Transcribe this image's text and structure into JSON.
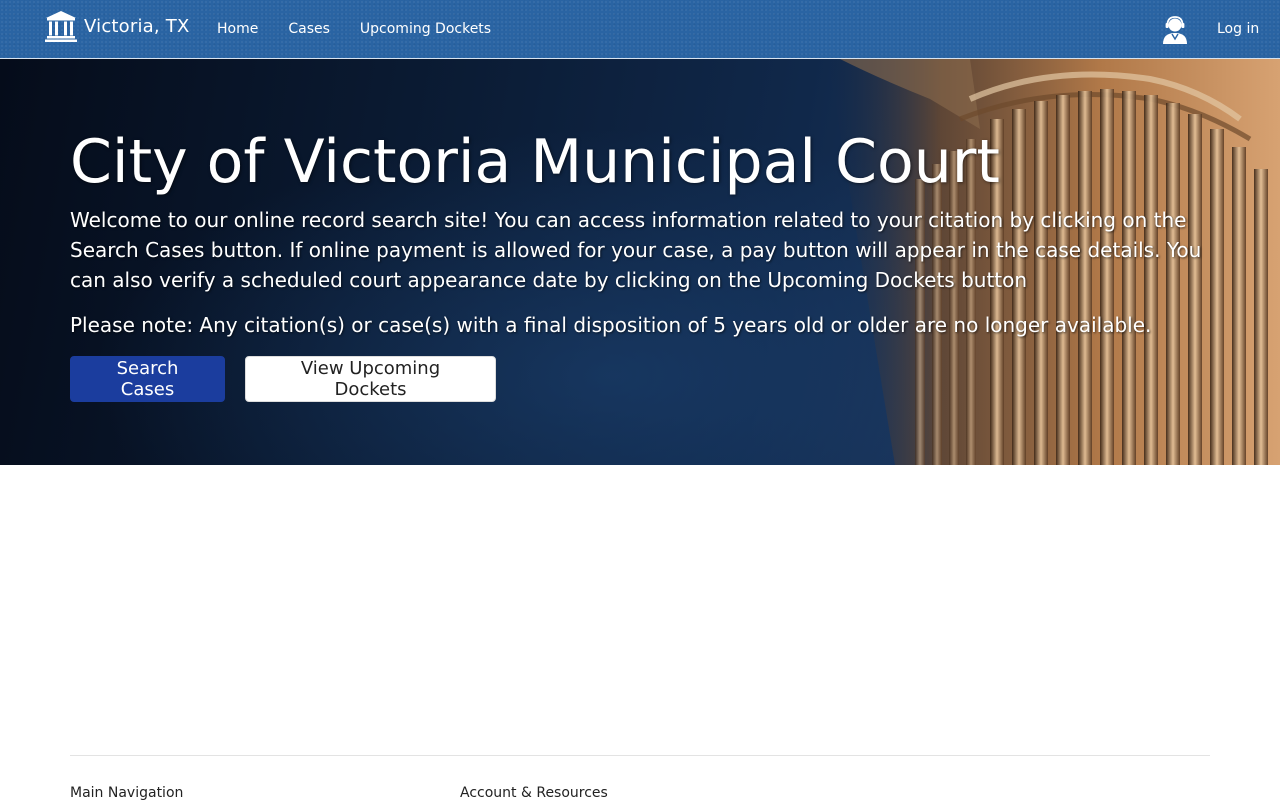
{
  "navbar": {
    "brand_text": "Victoria, TX",
    "brand_icon": "courthouse-icon",
    "links": [
      {
        "label": "Home"
      },
      {
        "label": "Cases"
      },
      {
        "label": "Upcoming Dockets"
      }
    ],
    "user_icon": "user-support-icon",
    "login_label": "Log in",
    "background_color": "#2a64a3"
  },
  "hero": {
    "title": "City of Victoria Municipal Court",
    "welcome_text": "Welcome to our online record search site! You can access information related to your citation by clicking on the Search Cases button. If online payment is allowed for your case, a pay button will appear in the case details. You can also verify a scheduled court appearance date by clicking on the Upcoming Dockets button",
    "note_text": "Please note: Any citation(s) or case(s) with a final disposition of 5 years old or older are no longer available.",
    "primary_button_label": "Search Cases",
    "secondary_button_label": "View Upcoming Dockets",
    "primary_button_color": "#1b3d9e"
  },
  "footer": {
    "headings": [
      {
        "label": "Main Navigation"
      },
      {
        "label": "Account & Resources"
      }
    ]
  }
}
